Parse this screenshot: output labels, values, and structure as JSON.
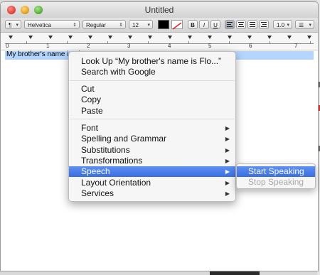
{
  "window": {
    "title": "Untitled"
  },
  "toolbar": {
    "paragraph_style": "¶",
    "font_family": "Helvetica",
    "font_style": "Regular",
    "font_size": "12",
    "bold": "B",
    "italic": "I",
    "underline": "U",
    "line_spacing": "1.0",
    "list": "☰"
  },
  "ruler": {
    "numbers": [
      "0",
      "1",
      "2",
      "3",
      "4",
      "5",
      "6",
      "7"
    ]
  },
  "document": {
    "text": "My brother's name is Flo"
  },
  "context_menu": {
    "items": [
      {
        "label": "Look Up “My brother's name is Flo...”"
      },
      {
        "label": "Search with Google"
      },
      {
        "label": "Cut"
      },
      {
        "label": "Copy"
      },
      {
        "label": "Paste"
      },
      {
        "label": "Font"
      },
      {
        "label": "Spelling and Grammar"
      },
      {
        "label": "Substitutions"
      },
      {
        "label": "Transformations"
      },
      {
        "label": "Speech",
        "highlighted": true
      },
      {
        "label": "Layout Orientation"
      },
      {
        "label": "Services"
      }
    ],
    "submenu_arrow": "▶"
  },
  "speech_submenu": {
    "items": [
      {
        "label": "Start Speaking",
        "highlighted": true
      },
      {
        "label": "Stop Speaking",
        "disabled": true
      }
    ]
  },
  "colors": {
    "selection": "#b4d5fe",
    "highlight": "#3b6fe0"
  }
}
